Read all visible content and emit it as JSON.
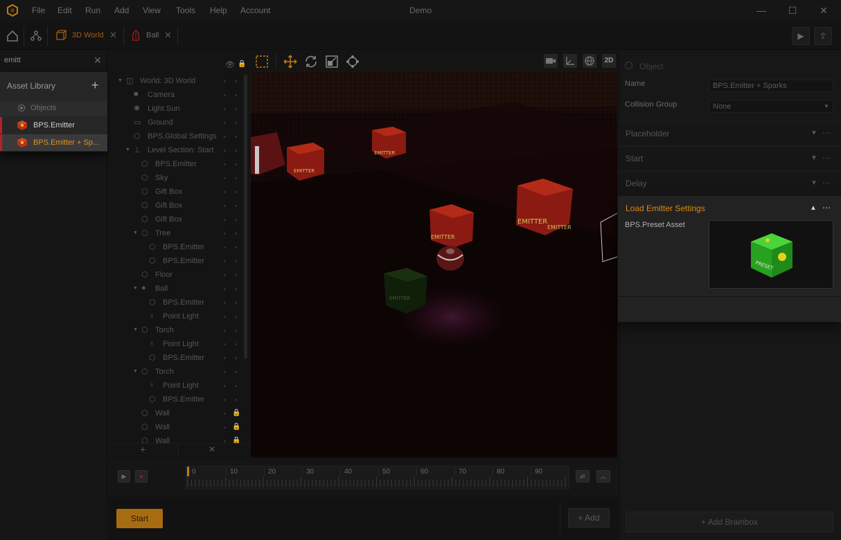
{
  "window": {
    "title": "Demo",
    "menu": [
      "File",
      "Edit",
      "Run",
      "Add",
      "View",
      "Tools",
      "Help",
      "Account"
    ],
    "controls": {
      "minimize": "—",
      "maximize": "☐",
      "close": "✕"
    }
  },
  "tabs": [
    {
      "label": "3D World",
      "icon": "world-cube-icon",
      "active": true
    },
    {
      "label": "Ball",
      "icon": "ball-figure-icon",
      "active": false
    }
  ],
  "search": {
    "value": "emitt",
    "clear": "✕"
  },
  "asset_library": {
    "title": "Asset Library",
    "add": "+",
    "category": "Objects",
    "items": [
      "BPS.Emitter",
      "BPS.Emitter + Sp..."
    ]
  },
  "hierarchy": {
    "rows": [
      {
        "label": "World: 3D World",
        "indent": 0,
        "arrow": "▼",
        "icon": "world-icon",
        "lock": false
      },
      {
        "label": "Camera",
        "indent": 1,
        "arrow": "",
        "icon": "camera-icon",
        "lock": false
      },
      {
        "label": "Light Sun",
        "indent": 1,
        "arrow": "",
        "icon": "sun-icon",
        "lock": false
      },
      {
        "label": "Ground",
        "indent": 1,
        "arrow": "",
        "icon": "ground-icon",
        "lock": false
      },
      {
        "label": "BPS.Global Settings",
        "indent": 1,
        "arrow": "",
        "icon": "hexagon-icon",
        "lock": false
      },
      {
        "label": "Level Section: Start",
        "indent": 1,
        "arrow": "▼",
        "icon": "level-section-icon",
        "lock": false
      },
      {
        "label": "BPS.Emitter",
        "indent": 2,
        "arrow": "",
        "icon": "hexagon-icon",
        "lock": false
      },
      {
        "label": "Sky",
        "indent": 2,
        "arrow": "",
        "icon": "hexagon-icon",
        "lock": false
      },
      {
        "label": "Gift Box",
        "indent": 2,
        "arrow": "",
        "icon": "hexagon-icon",
        "lock": false
      },
      {
        "label": "Gift Box",
        "indent": 2,
        "arrow": "",
        "icon": "hexagon-icon",
        "lock": false
      },
      {
        "label": "Gift Box",
        "indent": 2,
        "arrow": "",
        "icon": "hexagon-icon",
        "lock": false
      },
      {
        "label": "Tree",
        "indent": 2,
        "arrow": "▼",
        "icon": "hexagon-icon",
        "lock": false
      },
      {
        "label": "BPS.Emitter",
        "indent": 3,
        "arrow": "",
        "icon": "hexagon-icon",
        "lock": false
      },
      {
        "label": "BPS.Emitter",
        "indent": 3,
        "arrow": "",
        "icon": "hexagon-icon",
        "lock": false
      },
      {
        "label": "Floor",
        "indent": 2,
        "arrow": "",
        "icon": "hexagon-icon",
        "lock": false
      },
      {
        "label": "Ball",
        "indent": 2,
        "arrow": "▼",
        "icon": "person-icon",
        "lock": false
      },
      {
        "label": "BPS.Emitter",
        "indent": 3,
        "arrow": "",
        "icon": "hexagon-icon",
        "lock": false
      },
      {
        "label": "Point Light",
        "indent": 3,
        "arrow": "",
        "icon": "bulb-icon",
        "lock": false
      },
      {
        "label": "Torch",
        "indent": 2,
        "arrow": "▼",
        "icon": "hexagon-icon",
        "lock": false
      },
      {
        "label": "Point Light",
        "indent": 3,
        "arrow": "",
        "icon": "bulb-icon",
        "lock": false
      },
      {
        "label": "BPS.Emitter",
        "indent": 3,
        "arrow": "",
        "icon": "hexagon-icon",
        "lock": false
      },
      {
        "label": "Torch",
        "indent": 2,
        "arrow": "▼",
        "icon": "hexagon-icon",
        "lock": false
      },
      {
        "label": "Point Light",
        "indent": 3,
        "arrow": "",
        "icon": "bulb-icon",
        "lock": false
      },
      {
        "label": "BPS.Emitter",
        "indent": 3,
        "arrow": "",
        "icon": "hexagon-icon",
        "lock": false
      },
      {
        "label": "Wall",
        "indent": 2,
        "arrow": "",
        "icon": "hexagon-icon",
        "lock": true
      },
      {
        "label": "Wall",
        "indent": 2,
        "arrow": "",
        "icon": "hexagon-icon",
        "lock": true
      },
      {
        "label": "Wall",
        "indent": 2,
        "arrow": "",
        "icon": "hexagon-icon",
        "lock": true
      }
    ],
    "footer": {
      "add": "+",
      "remove": "✕"
    }
  },
  "viewport": {
    "mode_2d": "2D",
    "tools": [
      "select-rect-icon",
      "move-icon",
      "rotate-icon",
      "scale-icon",
      "pivot-icon"
    ],
    "right_tools": [
      "camera-icon",
      "axes-icon",
      "globe-icon"
    ]
  },
  "timeline": {
    "ticks": [
      "0",
      "10",
      "20",
      "30",
      "40",
      "50",
      "60",
      "70",
      "80",
      "90"
    ],
    "play": "▶",
    "record": "●"
  },
  "bottom": {
    "start_label": "Start",
    "add_label": "+ Add"
  },
  "inspector": {
    "object_title": "Object",
    "name_label": "Name",
    "name_value": "BPS.Emitter + Sparks",
    "collision_label": "Collision Group",
    "collision_value": "None",
    "sections": [
      "Placeholder",
      "Start",
      "Delay"
    ],
    "emitter_title": "Load Emitter Settings",
    "preset_label": "BPS.Preset Asset",
    "brainbox_label": "+ Add Brainbox",
    "accent_color": "#d98a14"
  }
}
